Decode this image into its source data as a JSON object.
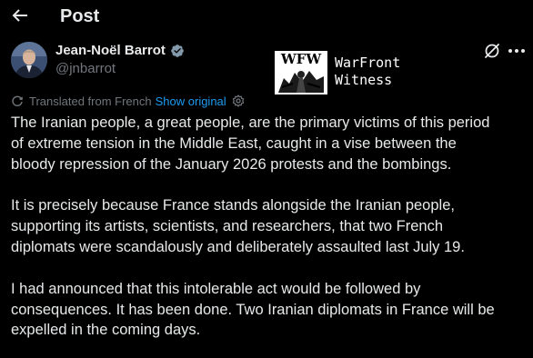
{
  "header": {
    "back_icon": "arrow-left-icon",
    "title": "Post"
  },
  "author": {
    "name": "Jean-Noël Barrot",
    "handle": "@jnbarrot",
    "verified_icon": "verified-badge-icon",
    "badge_color": "#829aab"
  },
  "watermark": {
    "logo_text": "WFW",
    "line1": "WarFront",
    "line2": "Witness"
  },
  "actions": {
    "grok_icon": "grok-icon",
    "more_icon": "more-icon"
  },
  "translation": {
    "label": "Translated from French",
    "show_original": "Show original",
    "settings_icon": "settings-icon"
  },
  "post": {
    "paragraphs": [
      {
        "lines": [
          "The Iranian people, a great people, are the primary victims of this period",
          "of extreme tension in the Middle East, caught in a vise between the",
          "bloody repression of the January 2026 protests and the bombings."
        ]
      },
      {
        "lines": [
          "It is precisely because France stands alongside the Iranian people,",
          "supporting its artists, scientists, and researchers, that two French",
          "diplomats were scandalously and deliberately assaulted last July 19."
        ]
      },
      {
        "lines": [
          "I had announced that this intolerable act would be followed by",
          "consequences. It has been done. Two Iranian diplomats in France will be",
          "expelled in the coming days."
        ]
      }
    ]
  },
  "colors": {
    "background": "#000000",
    "text": "#e7e9ea",
    "secondary": "#71767b",
    "link": "#1d9bf0"
  }
}
